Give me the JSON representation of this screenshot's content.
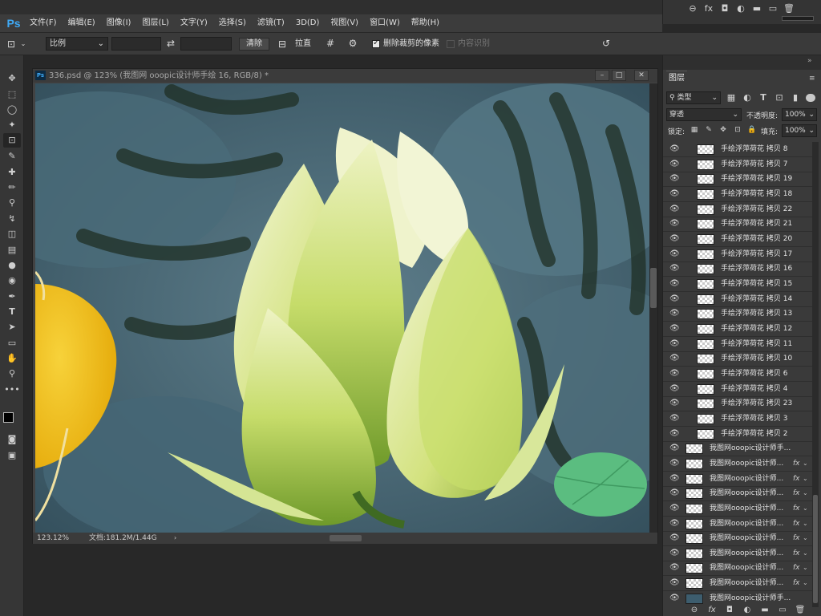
{
  "app": {
    "logo": "Ps"
  },
  "menu": [
    {
      "label": "文件(F)"
    },
    {
      "label": "编辑(E)"
    },
    {
      "label": "图像(I)"
    },
    {
      "label": "图层(L)"
    },
    {
      "label": "文字(Y)"
    },
    {
      "label": "选择(S)"
    },
    {
      "label": "滤镜(T)"
    },
    {
      "label": "3D(D)"
    },
    {
      "label": "视图(V)"
    },
    {
      "label": "窗口(W)"
    },
    {
      "label": "帮助(H)"
    }
  ],
  "options": {
    "ratio_select": "比例",
    "clear_button": "清除",
    "straighten_label": "拉直",
    "delete_cropped_label": "删除裁剪的像素",
    "delete_cropped_checked": true,
    "content_aware_label": "内容识别",
    "content_aware_checked": false
  },
  "document": {
    "title": "336.psd @ 123% (我图网 ooopic设计师手绘 16, RGB/8) *",
    "zoom": "123.12%",
    "doc_info": "文档:181.2M/1.44G"
  },
  "layers_panel": {
    "tab_label": "图层",
    "filter_select": "类型",
    "blend_mode": "穿透",
    "opacity_label": "不透明度:",
    "opacity_value": "100%",
    "lock_label": "锁定:",
    "fill_label": "填充:",
    "fill_value": "100%",
    "layers": [
      {
        "name": "手绘浮萍荷花 拷贝 8",
        "fx": false
      },
      {
        "name": "手绘浮萍荷花 拷贝 7",
        "fx": false
      },
      {
        "name": "手绘浮萍荷花 拷贝 19",
        "fx": false
      },
      {
        "name": "手绘浮萍荷花 拷贝 18",
        "fx": false
      },
      {
        "name": "手绘浮萍荷花 拷贝 22",
        "fx": false
      },
      {
        "name": "手绘浮萍荷花 拷贝 21",
        "fx": false
      },
      {
        "name": "手绘浮萍荷花 拷贝 20",
        "fx": false
      },
      {
        "name": "手绘浮萍荷花 拷贝 17",
        "fx": false
      },
      {
        "name": "手绘浮萍荷花 拷贝 16",
        "fx": false
      },
      {
        "name": "手绘浮萍荷花 拷贝 15",
        "fx": false
      },
      {
        "name": "手绘浮萍荷花 拷贝 14",
        "fx": false
      },
      {
        "name": "手绘浮萍荷花 拷贝 13",
        "fx": false
      },
      {
        "name": "手绘浮萍荷花 拷贝 12",
        "fx": false
      },
      {
        "name": "手绘浮萍荷花 拷贝 11",
        "fx": false
      },
      {
        "name": "手绘浮萍荷花 拷贝 10",
        "fx": false
      },
      {
        "name": "手绘浮萍荷花 拷贝 6",
        "fx": false
      },
      {
        "name": "手绘浮萍荷花 拷贝 4",
        "fx": false
      },
      {
        "name": "手绘浮萍荷花 拷贝 23",
        "fx": false
      },
      {
        "name": "手绘浮萍荷花 拷贝 3",
        "fx": false
      },
      {
        "name": "手绘浮萍荷花 拷贝 2",
        "fx": false
      },
      {
        "name": "我图网ooopic设计师手...",
        "fx": false
      },
      {
        "name": "我图网ooopic设计师...",
        "fx": true
      },
      {
        "name": "我图网ooopic设计师...",
        "fx": true
      },
      {
        "name": "我图网ooopic设计师...",
        "fx": true
      },
      {
        "name": "我图网ooopic设计师...",
        "fx": true
      },
      {
        "name": "我图网ooopic设计师...",
        "fx": true
      },
      {
        "name": "我图网ooopic设计师...",
        "fx": true
      },
      {
        "name": "我图网ooopic设计师...",
        "fx": true
      },
      {
        "name": "我图网ooopic设计师...",
        "fx": true
      },
      {
        "name": "我图网ooopic设计师...",
        "fx": true
      },
      {
        "name": "我图网ooopic设计师手...",
        "fx": false
      }
    ],
    "fx_label": "fx"
  },
  "colors": {
    "accent": "#3fa9f5",
    "panel": "#3a3a3a",
    "canvas_water": "#3d5d6e",
    "lotus_green": "#c8dc6a",
    "yellow_petal": "#f2c31c"
  }
}
